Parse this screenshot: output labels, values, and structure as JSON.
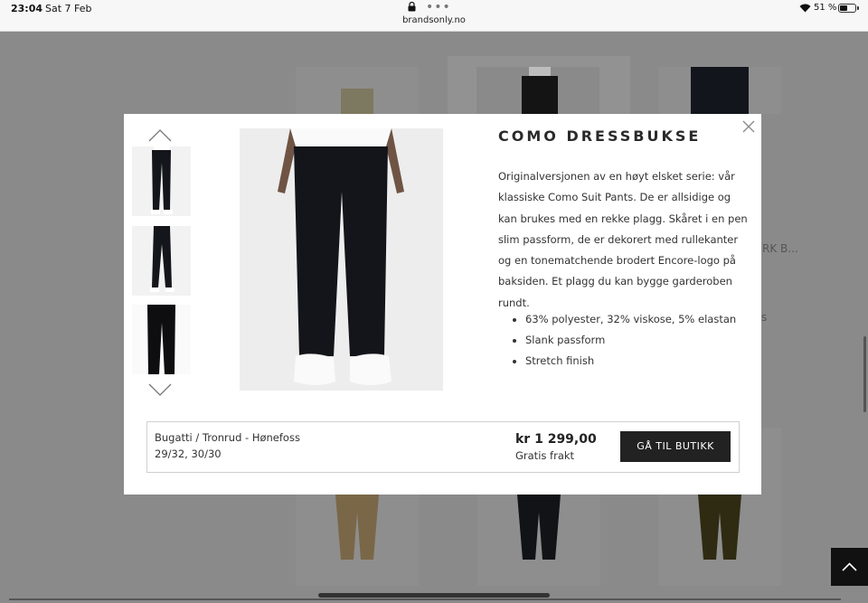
{
  "status_bar": {
    "time": "23:04",
    "date": "Sat 7 Feb",
    "url": "brandsonly.no",
    "battery": "51 %"
  },
  "background": {
    "product_name_truncated": "RK B...",
    "price_fragment": "s"
  },
  "modal": {
    "title": "COMO DRESSBUKSE",
    "description": "Originalversjonen av en høyt elsket serie: vår klassiske Como Suit Pants. De er allsidige og kan brukes med en rekke plagg. Skåret i en pen slim passform, de er dekorert med rullekanter og en tonematchende brodert Encore-logo på baksiden. Et plagg du kan bygge garderoben rundt.",
    "features": [
      "63% polyester, 32% viskose, 5% elastan",
      "Slank passform",
      "Stretch finish"
    ],
    "offer": {
      "shop": "Bugatti / Tronrud - Hønefoss",
      "sizes": "29/32, 30/30",
      "price": "kr 1 299,00",
      "shipping": "Gratis frakt",
      "button_label": "GÅ TIL BUTIKK"
    }
  },
  "colors": {
    "button_bg": "#222222",
    "overlay": "#8a8a8a"
  }
}
